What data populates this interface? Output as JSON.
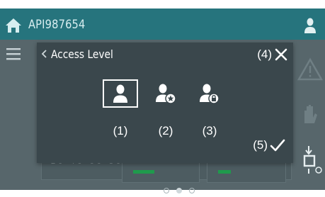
{
  "header": {
    "device_id": "API987654"
  },
  "dialog": {
    "title": "Access Level",
    "close_marker": "(4)",
    "confirm_marker": "(5)",
    "levels": [
      {
        "label": "(1)",
        "icon": "user-icon",
        "selected": true
      },
      {
        "label": "(2)",
        "icon": "user-star-icon",
        "selected": false
      },
      {
        "label": "(3)",
        "icon": "user-lock-icon",
        "selected": false
      }
    ]
  },
  "background": {
    "scale_text": "20 40 60 80"
  },
  "pager": {
    "count": 3,
    "active_index": 1
  },
  "colors": {
    "header": "#26747d",
    "content": "#57666b",
    "dialog": "#3a474c",
    "accent_bar": "#1f9a4c"
  }
}
